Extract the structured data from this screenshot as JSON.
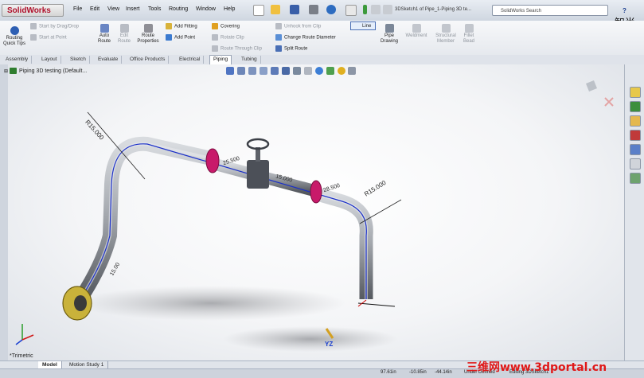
{
  "app": {
    "logo": "SolidWorks",
    "menus": [
      "File",
      "Edit",
      "View",
      "Insert",
      "Tools",
      "Routing",
      "Window",
      "Help"
    ],
    "doc_title": "3DSketch1 of Pipe_1-Piping 3D te...",
    "search_placeholder": "SolidWorks Search",
    "help": "?"
  },
  "commands": {
    "routing_quick_tips": "Routing Quick Tips",
    "start_drag_drop": "Start by Drag/Drop",
    "start_at_point": "Start at Point",
    "auto_route": "Auto Route",
    "edit_route": "Edit Route",
    "route_properties": "Route Properties",
    "add_fitting": "Add Fitting",
    "add_point": "Add Point",
    "covering": "Covering",
    "rotate_clip": "Rotate Clip",
    "route_through_clip": "Route Through Clip",
    "unhook_from_clip": "Unhook from Clip",
    "change_route_diameter": "Change Route Diameter",
    "split_route": "Split Route",
    "line": "Line",
    "pipe_drawing": "Pipe Drawing",
    "weldment": "Weldment",
    "structural_member": "Structural Member",
    "fillet_bead": "Fillet Bead"
  },
  "tabs": [
    "Assembly",
    "Layout",
    "Sketch",
    "Evaluate",
    "Office Products",
    "Electrical",
    "Piping",
    "Tubing"
  ],
  "active_tab": "Piping",
  "tree": {
    "root": "Piping 3D testing  (Default..."
  },
  "viewport": {
    "view_name": "*Trimetric",
    "dims": {
      "r1": "R15.000",
      "r2": "R15.000",
      "d1": "25.500",
      "d2": "15.000",
      "d3": "28.500",
      "d4": "15.00"
    }
  },
  "bottom_tabs": [
    "Model",
    "Motion Study 1"
  ],
  "status": {
    "x": "97.61in",
    "y": "-10.85in",
    "z": "-44.14in",
    "state": "Under Defined",
    "editing": "Editing 3DSketch1"
  },
  "watermark": "三维网www.3dportal.cn",
  "watermark_top": "智尚"
}
